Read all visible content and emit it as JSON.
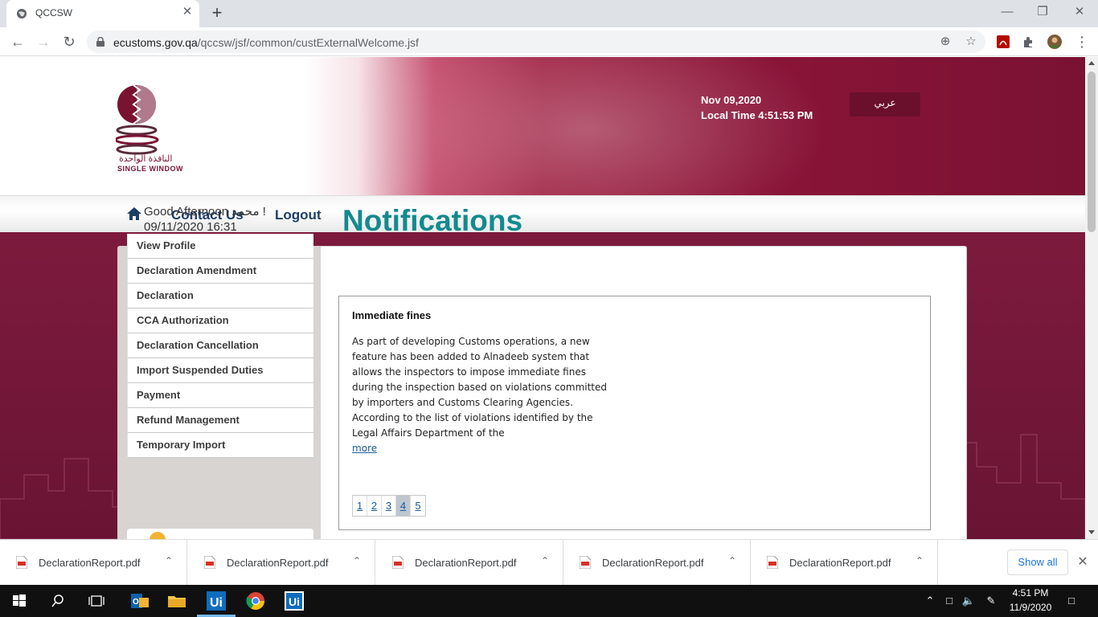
{
  "browser": {
    "tab_title": "QCCSW",
    "tab_close": "✕",
    "new_tab": "+",
    "url_domain": "ecustoms.gov.qa",
    "url_path": "/qccsw/jsf/common/custExternalWelcome.jsf"
  },
  "header": {
    "logo_text_arabic": "النافذة الواحدة",
    "logo_text_english": "SINGLE WINDOW",
    "date": "Nov 09,2020",
    "local_time": "Local Time 4:51:53 PM",
    "language_button": "عربي"
  },
  "navbar": {
    "items": [
      {
        "label": "Contact Us"
      },
      {
        "label": "Logout"
      }
    ]
  },
  "sidebar": {
    "greeting": "Good Afternoon محمد !",
    "datetime": "09/11/2020 16:31",
    "menu": [
      {
        "label": "View Profile"
      },
      {
        "label": "Declaration Amendment"
      },
      {
        "label": "Declaration"
      },
      {
        "label": "CCA Authorization"
      },
      {
        "label": "Declaration Cancellation"
      },
      {
        "label": "Import Suspended Duties"
      },
      {
        "label": "Payment"
      },
      {
        "label": "Refund Management"
      },
      {
        "label": "Temporary Import"
      }
    ]
  },
  "notifications": {
    "title": "Notifications",
    "item_title": "Immediate fines",
    "item_body": "As part of developing Customs operations, a new feature has been added to Alnadeeb system that allows the inspectors to impose immediate fines during the inspection based on violations committed by importers and Customs Clearing Agencies. According to the list of violations identified by the Legal Affairs Department of the",
    "more_link": "more",
    "pages": [
      "1",
      "2",
      "3",
      "4",
      "5"
    ],
    "active_page": "4"
  },
  "downloads": {
    "items": [
      {
        "name": "DeclarationReport.pdf"
      },
      {
        "name": "DeclarationReport.pdf"
      },
      {
        "name": "DeclarationReport.pdf"
      },
      {
        "name": "DeclarationReport.pdf"
      },
      {
        "name": "DeclarationReport.pdf"
      }
    ],
    "show_all": "Show all"
  },
  "taskbar": {
    "time": "4:51 PM",
    "date": "11/9/2020"
  },
  "colors": {
    "brand_maroon": "#7a1233",
    "notification_teal": "#138a8f",
    "nav_link_blue": "#1e3e66"
  }
}
